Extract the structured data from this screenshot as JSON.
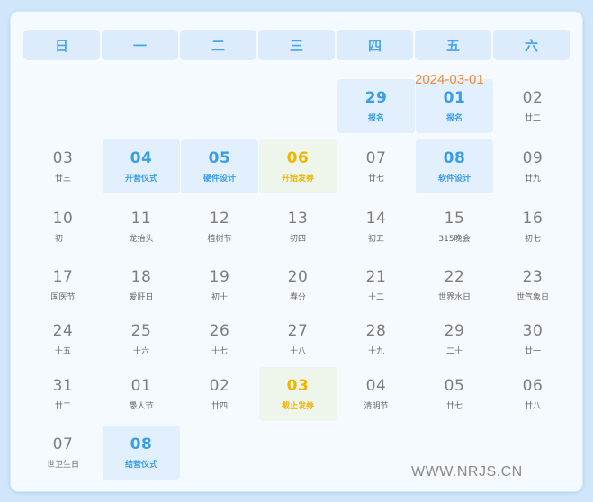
{
  "weekdays": [
    "日",
    "一",
    "二",
    "三",
    "四",
    "五",
    "六"
  ],
  "date_stamp": "2024-03-01",
  "watermark": "WWW.NRJS.CN",
  "cells": [
    {
      "row": 0,
      "col": 4,
      "day": "29",
      "label": "报名",
      "style": "blue"
    },
    {
      "row": 0,
      "col": 5,
      "day": "01",
      "label": "报名",
      "style": "blue"
    },
    {
      "row": 0,
      "col": 6,
      "day": "02",
      "label": "廿二",
      "style": "plain"
    },
    {
      "row": 1,
      "col": 0,
      "day": "03",
      "label": "廿三",
      "style": "plain"
    },
    {
      "row": 1,
      "col": 1,
      "day": "04",
      "label": "开营仪式",
      "style": "blue"
    },
    {
      "row": 1,
      "col": 2,
      "day": "05",
      "label": "硬件设计",
      "style": "blue"
    },
    {
      "row": 1,
      "col": 3,
      "day": "06",
      "label": "开始发券",
      "style": "green"
    },
    {
      "row": 1,
      "col": 4,
      "day": "07",
      "label": "廿七",
      "style": "plain"
    },
    {
      "row": 1,
      "col": 5,
      "day": "08",
      "label": "软件设计",
      "style": "blue"
    },
    {
      "row": 1,
      "col": 6,
      "day": "09",
      "label": "廿九",
      "style": "plain"
    },
    {
      "row": 2,
      "col": 0,
      "day": "10",
      "label": "初一",
      "style": "plain"
    },
    {
      "row": 2,
      "col": 1,
      "day": "11",
      "label": "龙抬头",
      "style": "plain"
    },
    {
      "row": 2,
      "col": 2,
      "day": "12",
      "label": "植树节",
      "style": "plain"
    },
    {
      "row": 2,
      "col": 3,
      "day": "13",
      "label": "初四",
      "style": "plain"
    },
    {
      "row": 2,
      "col": 4,
      "day": "14",
      "label": "初五",
      "style": "plain"
    },
    {
      "row": 2,
      "col": 5,
      "day": "15",
      "label": "315晚会",
      "style": "plain"
    },
    {
      "row": 2,
      "col": 6,
      "day": "16",
      "label": "初七",
      "style": "plain"
    },
    {
      "row": 3,
      "col": 0,
      "day": "17",
      "label": "国医节",
      "style": "plain"
    },
    {
      "row": 3,
      "col": 1,
      "day": "18",
      "label": "爱肝日",
      "style": "plain"
    },
    {
      "row": 3,
      "col": 2,
      "day": "19",
      "label": "初十",
      "style": "plain"
    },
    {
      "row": 3,
      "col": 3,
      "day": "20",
      "label": "春分",
      "style": "plain"
    },
    {
      "row": 3,
      "col": 4,
      "day": "21",
      "label": "十二",
      "style": "plain"
    },
    {
      "row": 3,
      "col": 5,
      "day": "22",
      "label": "世界水日",
      "style": "plain"
    },
    {
      "row": 3,
      "col": 6,
      "day": "23",
      "label": "世气象日",
      "style": "plain"
    },
    {
      "row": 4,
      "col": 0,
      "day": "24",
      "label": "十五",
      "style": "plain"
    },
    {
      "row": 4,
      "col": 1,
      "day": "25",
      "label": "十六",
      "style": "plain"
    },
    {
      "row": 4,
      "col": 2,
      "day": "26",
      "label": "十七",
      "style": "plain"
    },
    {
      "row": 4,
      "col": 3,
      "day": "27",
      "label": "十八",
      "style": "plain"
    },
    {
      "row": 4,
      "col": 4,
      "day": "28",
      "label": "十九",
      "style": "plain"
    },
    {
      "row": 4,
      "col": 5,
      "day": "29",
      "label": "二十",
      "style": "plain"
    },
    {
      "row": 4,
      "col": 6,
      "day": "30",
      "label": "廿一",
      "style": "plain"
    },
    {
      "row": 5,
      "col": 0,
      "day": "31",
      "label": "廿二",
      "style": "plain"
    },
    {
      "row": 5,
      "col": 1,
      "day": "01",
      "label": "愚人节",
      "style": "plain"
    },
    {
      "row": 5,
      "col": 2,
      "day": "02",
      "label": "廿四",
      "style": "plain"
    },
    {
      "row": 5,
      "col": 3,
      "day": "03",
      "label": "截止发券",
      "style": "green"
    },
    {
      "row": 5,
      "col": 4,
      "day": "04",
      "label": "清明节",
      "style": "plain"
    },
    {
      "row": 5,
      "col": 5,
      "day": "05",
      "label": "廿七",
      "style": "plain"
    },
    {
      "row": 5,
      "col": 6,
      "day": "06",
      "label": "廿八",
      "style": "plain"
    },
    {
      "row": 6,
      "col": 0,
      "day": "07",
      "label": "世卫生日",
      "style": "plain"
    },
    {
      "row": 6,
      "col": 1,
      "day": "08",
      "label": "结营仪式",
      "style": "blue"
    }
  ]
}
